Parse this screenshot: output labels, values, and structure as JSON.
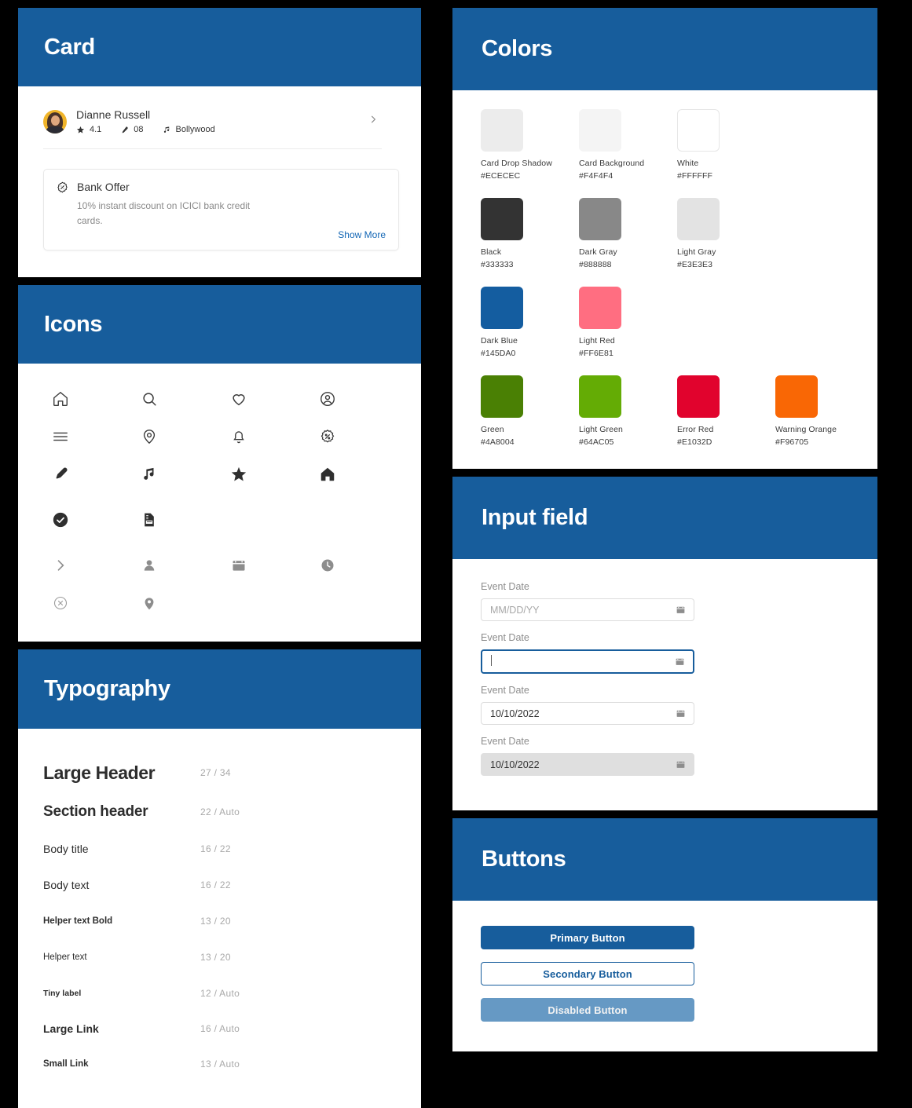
{
  "sections": {
    "card": "Card",
    "icons": "Icons",
    "typography": "Typography",
    "colors": "Colors",
    "input_field": "Input field",
    "buttons": "Buttons"
  },
  "card": {
    "profile": {
      "name": "Dianne Russell",
      "rating": "4.1",
      "songs": "08",
      "genre": "Bollywood"
    },
    "offer": {
      "title": "Bank Offer",
      "description": "10% instant discount on ICICI bank credit cards.",
      "link": "Show More"
    }
  },
  "icons": [
    {
      "name": "home-outline-icon"
    },
    {
      "name": "search-icon"
    },
    {
      "name": "heart-outline-icon"
    },
    {
      "name": "account-circle-outline-icon"
    },
    {
      "name": "menu-hamburger-icon"
    },
    {
      "name": "location-pin-outline-icon"
    },
    {
      "name": "bell-outline-icon"
    },
    {
      "name": "discount-badge-outline-icon"
    },
    {
      "name": "microphone-icon"
    },
    {
      "name": "music-note-icon"
    },
    {
      "name": "star-filled-icon"
    },
    {
      "name": "home-filled-icon"
    },
    {
      "name": "check-circle-filled-icon"
    },
    {
      "name": "document-invoice-icon"
    },
    {
      "name": "chevron-right-icon"
    },
    {
      "name": "person-filled-icon"
    },
    {
      "name": "calendar-icon"
    },
    {
      "name": "clock-filled-icon"
    },
    {
      "name": "close-circle-outline-icon"
    },
    {
      "name": "location-pin-filled-icon"
    }
  ],
  "typography": [
    {
      "label": "Large Header",
      "size": "27 / 34"
    },
    {
      "label": "Section header",
      "size": "22 / Auto"
    },
    {
      "label": "Body title",
      "size": "16 / 22"
    },
    {
      "label": "Body text",
      "size": "16 / 22"
    },
    {
      "label": "Helper text Bold",
      "size": "13 / 20"
    },
    {
      "label": "Helper text",
      "size": "13 / 20"
    },
    {
      "label": "Tiny label",
      "size": "12 / Auto"
    },
    {
      "label": "Large Link",
      "size": "16 / Auto"
    },
    {
      "label": "Small Link",
      "size": "13 / Auto"
    }
  ],
  "colors": [
    {
      "name": "Card Drop Shadow",
      "hex": "#ECECEC",
      "bordered": false
    },
    {
      "name": "Card Background",
      "hex": "#F4F4F4",
      "bordered": false
    },
    {
      "name": "White",
      "hex": "#FFFFFF",
      "bordered": true
    },
    {
      "name": "Black",
      "hex": "#333333",
      "bordered": false
    },
    {
      "name": "Dark Gray",
      "hex": "#888888",
      "bordered": false
    },
    {
      "name": "Light Gray",
      "hex": "#E3E3E3",
      "bordered": false
    },
    {
      "name": "Dark Blue",
      "hex": "#145DA0",
      "bordered": false
    },
    {
      "name": "Light Red",
      "hex": "#FF6E81",
      "bordered": false
    },
    {
      "name": "Green",
      "hex": "#4A8004",
      "bordered": false
    },
    {
      "name": "Light Green",
      "hex": "#64AC05",
      "bordered": false
    },
    {
      "name": "Error Red",
      "hex": "#E1032D",
      "bordered": false
    },
    {
      "name": "Warning Orange",
      "hex": "#F96705",
      "bordered": false
    }
  ],
  "inputs": [
    {
      "label": "Event Date",
      "value": "MM/DD/YY",
      "state": "placeholder"
    },
    {
      "label": "Event Date",
      "value": "",
      "state": "focused"
    },
    {
      "label": "Event Date",
      "value": "10/10/2022",
      "state": "filled"
    },
    {
      "label": "Event Date",
      "value": "10/10/2022",
      "state": "disabled"
    }
  ],
  "buttons": [
    {
      "label": "Primary Button",
      "variant": "primary"
    },
    {
      "label": "Secondary Button",
      "variant": "secondary"
    },
    {
      "label": "Disabled Button",
      "variant": "disabled"
    }
  ]
}
